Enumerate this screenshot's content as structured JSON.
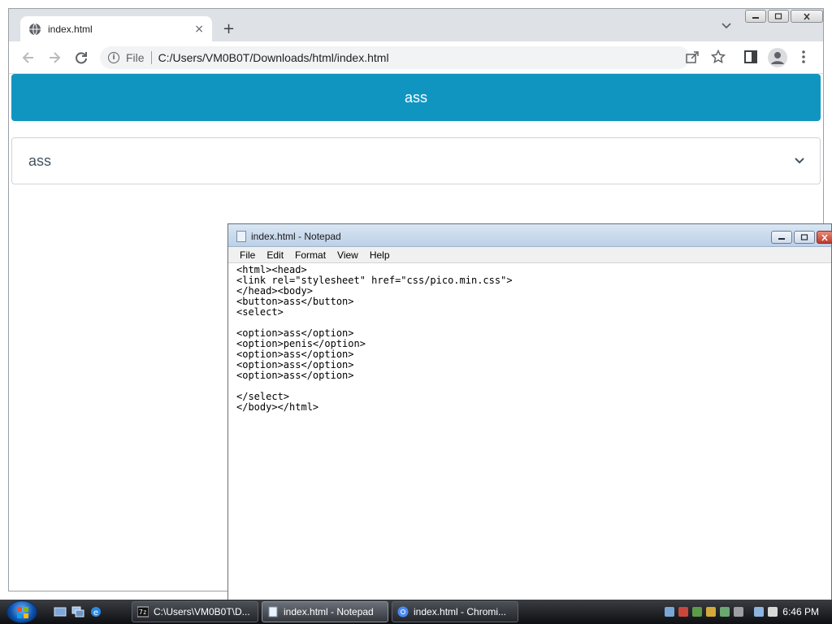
{
  "browser": {
    "tab_title": "index.html",
    "tab_close": "×",
    "new_tab": "+",
    "url_scheme": "File",
    "url": "C:/Users/VM0B0T/Downloads/html/index.html"
  },
  "page": {
    "button_label": "ass",
    "select_value": "ass"
  },
  "notepad": {
    "title": "index.html - Notepad",
    "menu": [
      "File",
      "Edit",
      "Format",
      "View",
      "Help"
    ],
    "lines": [
      "<html><head>",
      "<link rel=\"stylesheet\" href=\"css/pico.min.css\">",
      "</head><body>",
      "<button>ass</button>",
      "<select>",
      "",
      "<option>ass</option>",
      "<option>penis</option>",
      "<option>ass</option>",
      "<option>ass</option>",
      "<option>ass</option>",
      "",
      "</select>",
      "</body></html>"
    ]
  },
  "taskbar": {
    "items": [
      {
        "label": "C:\\Users\\VM0B0T\\D..."
      },
      {
        "label": "index.html - Notepad"
      },
      {
        "label": "index.html - Chromi..."
      }
    ],
    "clock": "6:46 PM"
  },
  "colors": {
    "pico_primary": "#1095c1",
    "select_border": "#cfd5db",
    "chrome_tabbar": "#dee1e6",
    "taskbar": "#1a1c20"
  },
  "icons": {
    "tab_favicon": "globe-icon",
    "back": "arrow-left-icon",
    "forward": "arrow-right-icon",
    "reload": "reload-icon",
    "info": "info-icon",
    "share": "share-icon",
    "bookmark": "star-icon",
    "side_panel": "side-panel-icon",
    "profile": "profile-icon",
    "menu": "kebab-menu-icon",
    "select_chevron": "chevron-down-icon"
  }
}
